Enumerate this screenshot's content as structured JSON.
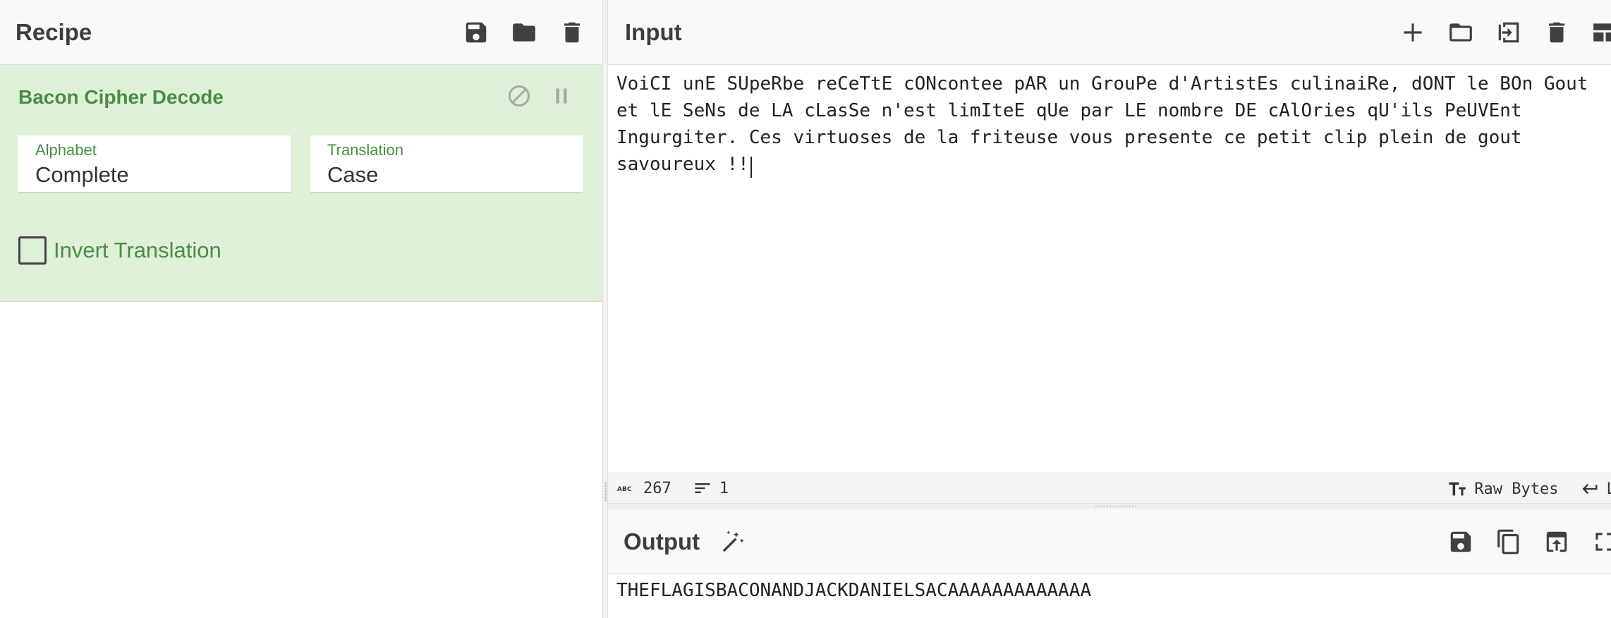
{
  "recipe": {
    "title": "Recipe",
    "icons": [
      "save-icon",
      "folder-icon",
      "trash-icon"
    ],
    "operation": {
      "title": "Bacon Cipher Decode",
      "controls": [
        "disable-icon",
        "pause-icon"
      ],
      "alphabet": {
        "label": "Alphabet",
        "value": "Complete"
      },
      "translation": {
        "label": "Translation",
        "value": "Case"
      },
      "invert": {
        "label": "Invert Translation",
        "checked": false
      }
    }
  },
  "input": {
    "title": "Input",
    "icons": [
      "plus-icon",
      "folder-icon",
      "load-file-icon",
      "trash-icon",
      "layout-icon"
    ],
    "text": "VoiCI unE SUpeRbe reCeTtE cONcontee pAR un GrouPe d'ArtistEs culinaiRe, dONT le BOn Gout et lE SeNs de LA cLasSe n'est limIteE qUe par LE nombre DE cAlOries qU'ils PeUVEnt Ingurgiter. Ces virtuoses de la friteuse vous presente ce petit clip plein de gout savoureux !!",
    "status": {
      "length": "267",
      "lines": "1",
      "encoding": "Raw Bytes",
      "eol": "LF"
    }
  },
  "output": {
    "title": "Output",
    "icons": [
      "magic-wand-icon",
      "save-icon",
      "copy-icon",
      "replace-input-icon",
      "maximize-icon"
    ],
    "text": "THEFLAGISBACONANDJACKDANIELSACAAAAAAAAAAAAA"
  },
  "colors": {
    "operation_bg": "#dff0d8",
    "operation_text": "#4c8c45",
    "header_bg": "#f9f9f9"
  }
}
